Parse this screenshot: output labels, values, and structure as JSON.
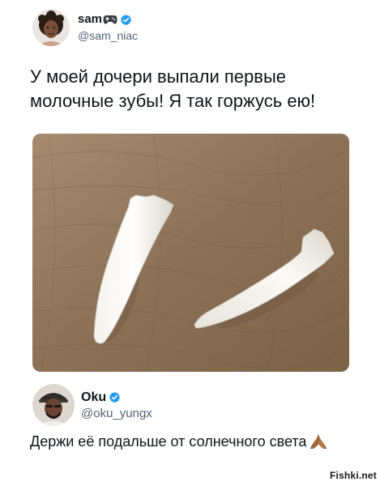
{
  "tweet": {
    "author_name": "sam",
    "author_handle": "@sam_niac",
    "name_emoji_icon": "gamepad-icon",
    "verified_icon": "verified-badge-icon",
    "verified_color": "#1d9bf0",
    "text_line1": "У моей дочери выпали первые",
    "text_line2": "молочные зубы! Я так горжусь ею!",
    "photo_subject": "teeth-photo"
  },
  "reply": {
    "author_name": "Oku",
    "author_handle": "@oku_yungx",
    "verified_icon": "verified-badge-icon",
    "text": "Держи её подальше от солнечного света",
    "emoji_icon": "praying-hands-icon"
  },
  "watermark": {
    "text": "Fishki.net"
  }
}
